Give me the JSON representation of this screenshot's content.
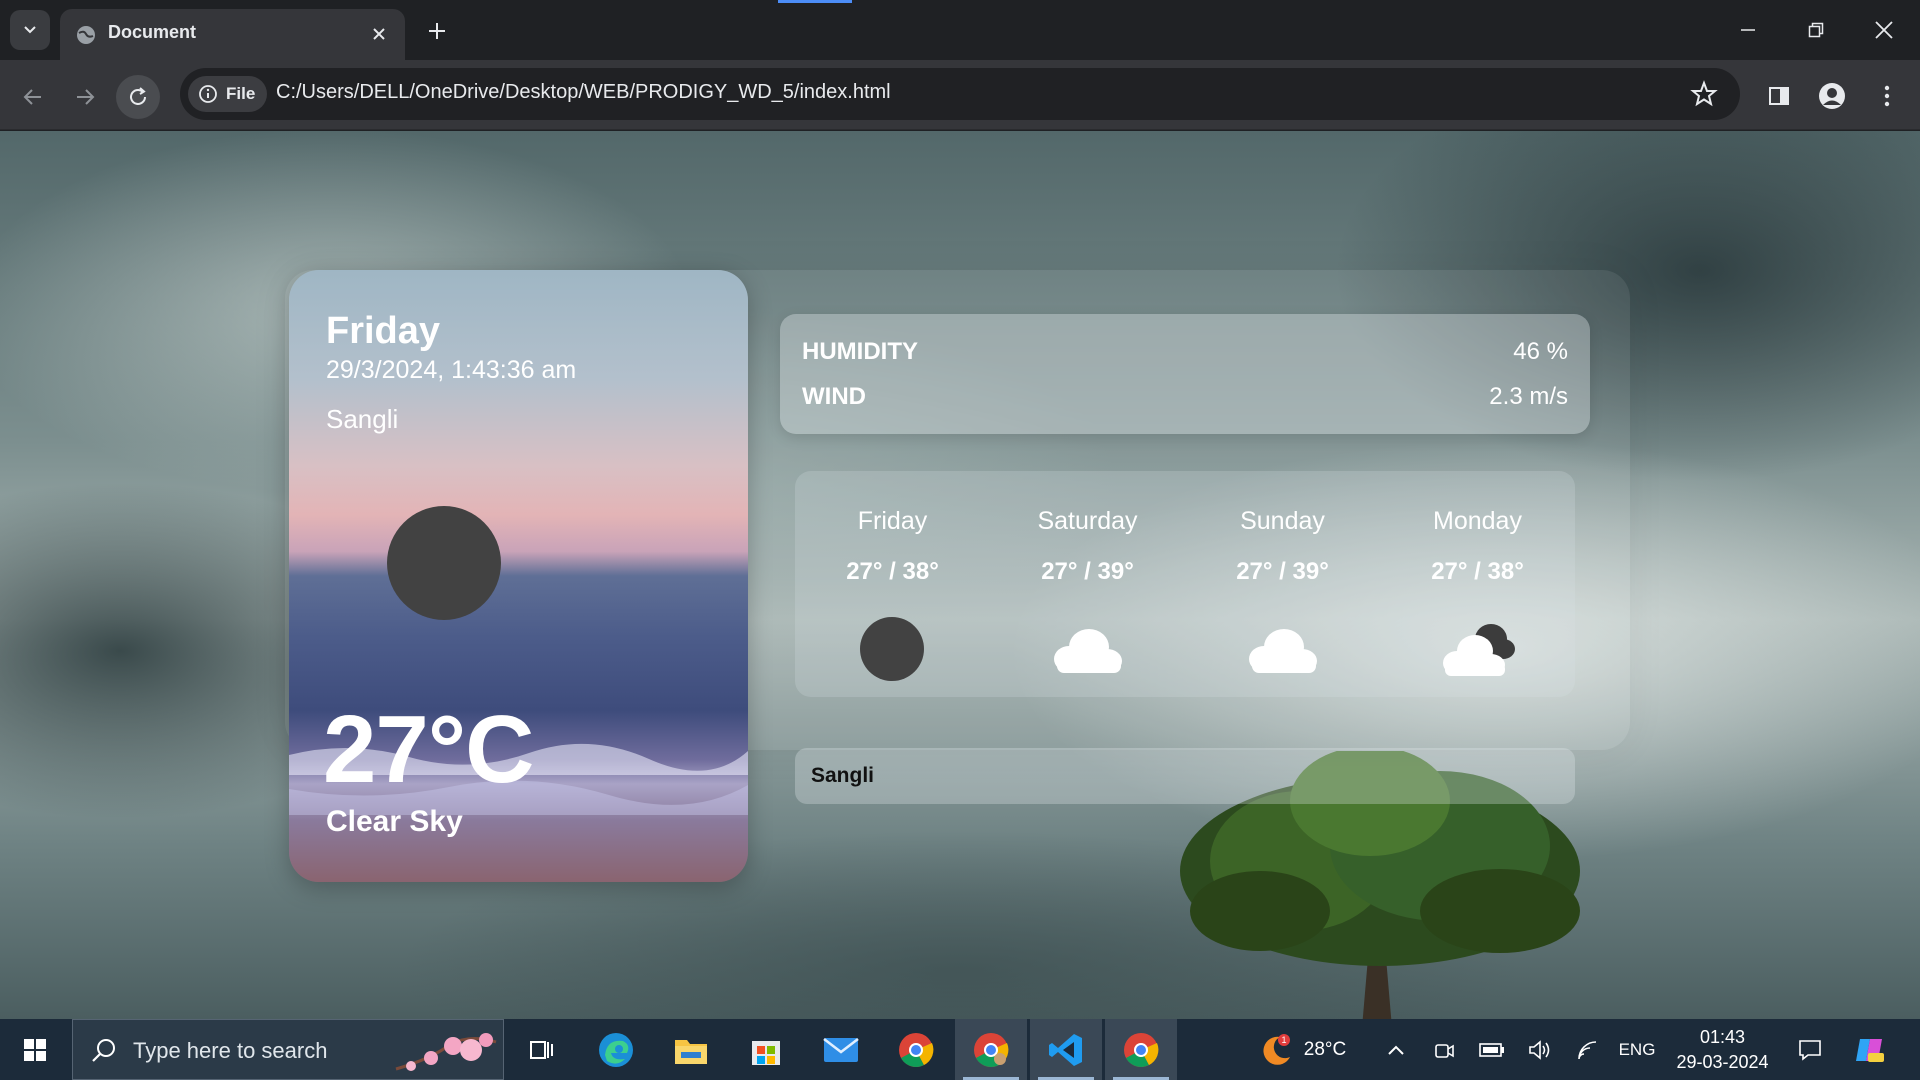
{
  "browser": {
    "tab_title": "Document",
    "file_chip": "File",
    "url": "C:/Users/DELL/OneDrive/Desktop/WEB/PRODIGY_WD_5/index.html"
  },
  "current": {
    "day": "Friday",
    "datetime": "29/3/2024, 1:43:36 am",
    "city": "Sangli",
    "temperature": "27°C",
    "description": "Clear Sky",
    "icon": "moon-icon"
  },
  "stats": {
    "humidity_label": "HUMIDITY",
    "humidity_value": "46 %",
    "wind_label": "WIND",
    "wind_value": "2.3 m/s"
  },
  "forecast": [
    {
      "day": "Friday",
      "range": "27° / 38°",
      "icon": "moon-icon"
    },
    {
      "day": "Saturday",
      "range": "27° / 39°",
      "icon": "cloud-icon"
    },
    {
      "day": "Sunday",
      "range": "27° / 39°",
      "icon": "cloud-icon"
    },
    {
      "day": "Monday",
      "range": "27° / 38°",
      "icon": "cloudy-night-icon"
    }
  ],
  "search": {
    "value": "Sangli"
  },
  "taskbar": {
    "search_placeholder": "Type here to search",
    "weather_temp": "28°C",
    "weather_badge": "1",
    "language": "ENG",
    "time": "01:43",
    "date": "29-03-2024"
  },
  "colors": {
    "chrome_bg": "#1f2124",
    "toolbar_bg": "#35363a",
    "taskbar_bg": "#1c2b3a",
    "icon_dark": "#424242"
  }
}
